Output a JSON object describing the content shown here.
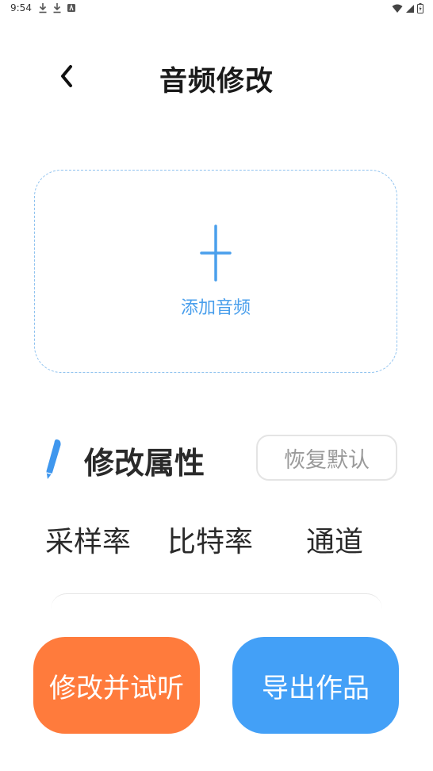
{
  "status_bar": {
    "time": "9:54"
  },
  "header": {
    "title": "音频修改"
  },
  "add_audio": {
    "label": "添加音频"
  },
  "attributes": {
    "title": "修改属性",
    "reset_label": "恢复默认",
    "labels": [
      "采样率",
      "比特率",
      "通道"
    ]
  },
  "actions": {
    "modify_label": "修改并试听",
    "export_label": "导出作品"
  },
  "colors": {
    "accent_blue": "#43a0f7",
    "accent_orange": "#ff7b3c",
    "dashed_border": "#8fc2ef"
  }
}
